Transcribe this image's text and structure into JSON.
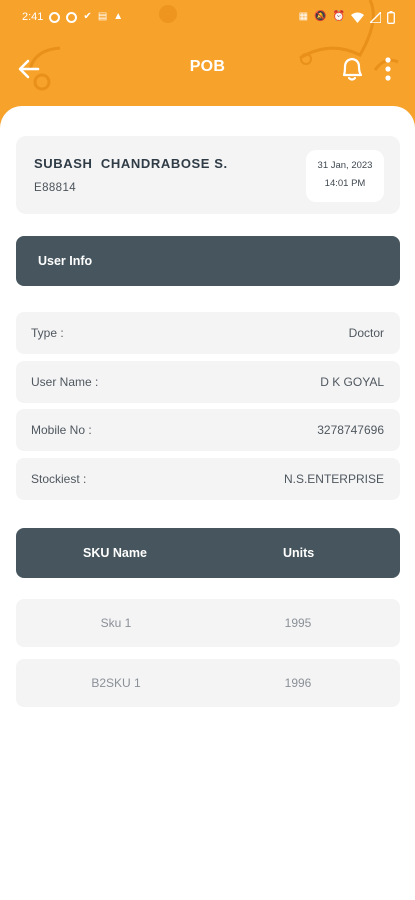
{
  "status_bar": {
    "time": "2:41",
    "icons": [
      "messenger-icon",
      "vpn-icon",
      "check-icon",
      "app-icon",
      "signal-app-icon",
      "data-icon",
      "mute-icon",
      "alarm-icon",
      "wifi-icon",
      "signal-icon",
      "battery-icon"
    ]
  },
  "header": {
    "title": "POB",
    "back_icon": "arrow-left-icon",
    "bell_icon": "bell-icon",
    "more_icon": "more-vertical-icon"
  },
  "profile": {
    "name": "SUBASH  CHANDRABOSE S.",
    "employee_id": "E88814",
    "date": "31 Jan, 2023",
    "time": "14:01 PM"
  },
  "user_info": {
    "heading": "User Info",
    "rows": [
      {
        "label": "Type :",
        "value": "Doctor"
      },
      {
        "label": "User Name :",
        "value": "D K GOYAL"
      },
      {
        "label": "Mobile No :",
        "value": "3278747696"
      },
      {
        "label": "Stockiest :",
        "value": "N.S.ENTERPRISE"
      }
    ]
  },
  "sku_table": {
    "headers": [
      "SKU Name",
      "Units"
    ],
    "rows": [
      {
        "sku": "Sku 1",
        "units": "1995"
      },
      {
        "sku": "B2SKU 1",
        "units": "1996"
      }
    ]
  },
  "colors": {
    "accent": "#f7a22a",
    "section_header": "#47565e",
    "row_background": "#f4f4f5"
  }
}
